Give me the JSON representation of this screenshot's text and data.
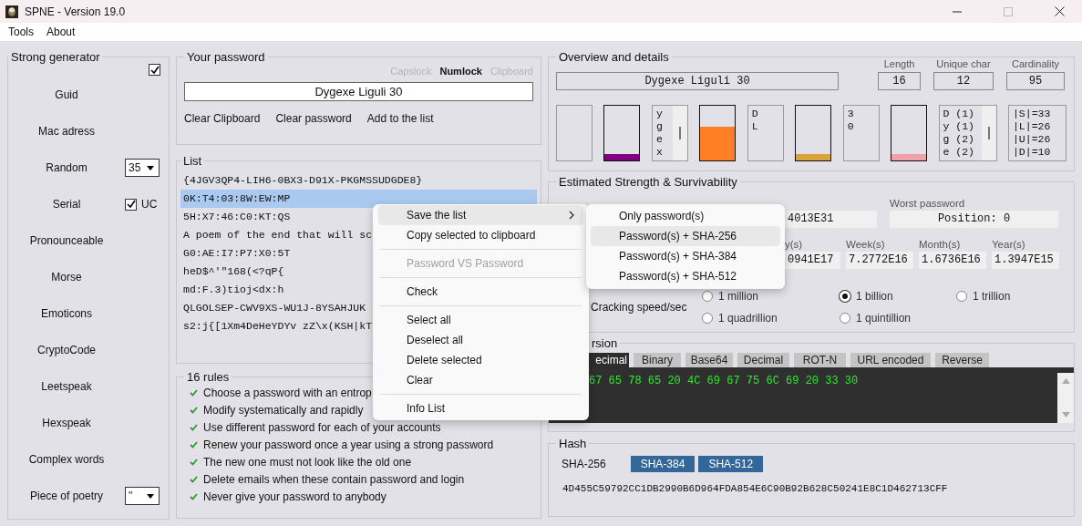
{
  "window": {
    "title": "SPNE - Version 19.0"
  },
  "menu_bar": [
    {
      "label": "Tools"
    },
    {
      "label": "About"
    }
  ],
  "generator": {
    "title": "Strong generator",
    "checked": true,
    "items": [
      {
        "kind": "button",
        "label": "Guid"
      },
      {
        "kind": "button",
        "label": "Mac adress"
      },
      {
        "kind": "spin",
        "label": "Random",
        "value": "35"
      },
      {
        "kind": "check",
        "label": "Serial",
        "option": "UC",
        "checked": true
      },
      {
        "kind": "button",
        "label": "Pronounceable"
      },
      {
        "kind": "button",
        "label": "Morse"
      },
      {
        "kind": "button",
        "label": "Emoticons"
      },
      {
        "kind": "button",
        "label": "CryptoCode"
      },
      {
        "kind": "button",
        "label": "Leetspeak"
      },
      {
        "kind": "button",
        "label": "Hexspeak"
      },
      {
        "kind": "button",
        "label": "Complex words"
      },
      {
        "kind": "combo",
        "label": "Piece of poetry",
        "value": "\""
      }
    ]
  },
  "password": {
    "title": "Your password",
    "indicators": [
      {
        "label": "Capslock",
        "on": false
      },
      {
        "label": "Numlock",
        "on": true
      },
      {
        "label": "Clipboard",
        "on": false
      }
    ],
    "value": "Dygexe Liguli 30",
    "actions": [
      "Clear Clipboard",
      "Clear password",
      "Add to the list"
    ]
  },
  "list": {
    "title": "List",
    "items": [
      {
        "text": "{4JGV3QP4-LIH6-0BX3-D91X-PKGMSSUDGDE8}",
        "selected": false
      },
      {
        "text": "0K:T4:03:8W:EW:MP",
        "selected": true
      },
      {
        "text": "5H:X7:46:C0:KT:QS",
        "selected": false
      },
      {
        "text": "A poem of the end that will sc",
        "selected": false
      },
      {
        "text": "G0:AE:I7:P7:X0:5T",
        "selected": false
      },
      {
        "text": "heD$^'\"168(<?qP{",
        "selected": false
      },
      {
        "text": "md:F.3)tioj<dx:h",
        "selected": false
      },
      {
        "text": "QLGOLSEP-CWV9XS-WU1J-8YSAHJUK",
        "selected": false
      },
      {
        "text": "s2:j{[1Xm4DeHeYDYv zZ\\x(KSH|kT",
        "selected": false
      }
    ]
  },
  "rules": {
    "title": "16 rules",
    "items": [
      "Choose a password with an entrop",
      "Modify systematically and rapidly",
      "Use different password for each of your accounts",
      "Renew your password once a year using a strong password",
      "The new one must not look like the old one",
      "Delete emails when these contain password and login",
      "Never give your password to anybody"
    ]
  },
  "overview": {
    "title": "Overview and details",
    "password": "Dygexe Liguli 30",
    "stats": [
      {
        "label": "Length",
        "value": "16"
      },
      {
        "label": "Unique char",
        "value": "12"
      },
      {
        "label": "Cardinality",
        "value": "95"
      }
    ],
    "boxes": [
      {
        "kind": "empty"
      },
      {
        "kind": "bar",
        "level": 0.12,
        "color": "#800080"
      },
      {
        "kind": "list",
        "lines": [
          "y",
          "g",
          "e",
          "x"
        ],
        "scrollbar": true
      },
      {
        "kind": "bar",
        "level": 0.62,
        "color": "#ff7f27"
      },
      {
        "kind": "list",
        "lines": [
          "D",
          "L"
        ],
        "scrollbar": false
      },
      {
        "kind": "bar",
        "level": 0.12,
        "color": "#d9a53a"
      },
      {
        "kind": "list",
        "lines": [
          "3",
          "0"
        ],
        "scrollbar": false
      },
      {
        "kind": "bar",
        "level": 0.12,
        "color": "#efa3a9"
      },
      {
        "kind": "list",
        "lines": [
          "D (1)",
          "y (1)",
          "g (2)",
          "e (2)"
        ],
        "scrollbar": true,
        "wide": true
      },
      {
        "kind": "list",
        "lines": [
          "|S|=33",
          "|L|=26",
          "|U|=26",
          "|D|=10"
        ],
        "scrollbar": false,
        "wide": true
      }
    ]
  },
  "strength": {
    "title": "Estimated Strength & Survivability",
    "possibilities": "4013E31",
    "worst_label": "Worst password",
    "worst_value": "Position: 0",
    "times": [
      {
        "label": "y(s)",
        "value": "0941E17"
      },
      {
        "label": "Week(s)",
        "value": "7.2772E16"
      },
      {
        "label": "Month(s)",
        "value": "1.6736E16"
      },
      {
        "label": "Year(s)",
        "value": "1.3947E15"
      }
    ],
    "speed_label": "Cracking speed/sec",
    "speeds": [
      {
        "label": "1 million",
        "selected": false
      },
      {
        "label": "1 billion",
        "selected": true
      },
      {
        "label": "1 trillion",
        "selected": false
      },
      {
        "label": "1 quadrillion",
        "selected": false
      },
      {
        "label": "1 quintillion",
        "selected": false
      }
    ]
  },
  "conversion": {
    "title": "rsion",
    "tabs": [
      {
        "label": "ecimal",
        "selected": true
      },
      {
        "label": "Binary",
        "selected": false
      },
      {
        "label": "Base64",
        "selected": false
      },
      {
        "label": "Decimal",
        "selected": false
      },
      {
        "label": "ROT-N",
        "selected": false
      },
      {
        "label": "URL encoded",
        "selected": false
      },
      {
        "label": "Reverse",
        "selected": false
      }
    ],
    "output": "67 65 78 65 20 4C 69 67 75 6C 69 20 33 30"
  },
  "hash": {
    "title": "Hash",
    "tabs": [
      {
        "label": "SHA-256",
        "selected": true
      },
      {
        "label": "SHA-384",
        "selected": false
      },
      {
        "label": "SHA-512",
        "selected": false
      }
    ],
    "value": "4D455C59792CC1DB2990B6D964FDA854E6C90B92B628C50241E8C1D462713CFF"
  },
  "context_menu": {
    "items": [
      {
        "kind": "submenu",
        "label": "Save the list",
        "selected": true,
        "disabled": false
      },
      {
        "kind": "item",
        "label": "Copy selected to clipboard",
        "selected": false,
        "disabled": false
      },
      {
        "kind": "separator"
      },
      {
        "kind": "item",
        "label": "Password VS Password",
        "selected": false,
        "disabled": true
      },
      {
        "kind": "separator"
      },
      {
        "kind": "item",
        "label": "Check",
        "selected": false,
        "disabled": false
      },
      {
        "kind": "separator"
      },
      {
        "kind": "item",
        "label": "Select all",
        "selected": false,
        "disabled": false
      },
      {
        "kind": "item",
        "label": "Deselect all",
        "selected": false,
        "disabled": false
      },
      {
        "kind": "item",
        "label": "Delete selected",
        "selected": false,
        "disabled": false
      },
      {
        "kind": "item",
        "label": "Clear",
        "selected": false,
        "disabled": false
      },
      {
        "kind": "separator"
      },
      {
        "kind": "item",
        "label": "Info List",
        "selected": false,
        "disabled": false
      }
    ]
  },
  "submenu": {
    "items": [
      {
        "label": "Only password(s)",
        "selected": false
      },
      {
        "label": "Password(s) + SHA-256",
        "selected": true
      },
      {
        "label": "Password(s) + SHA-384",
        "selected": false
      },
      {
        "label": "Password(s) + SHA-512",
        "selected": false
      }
    ]
  }
}
